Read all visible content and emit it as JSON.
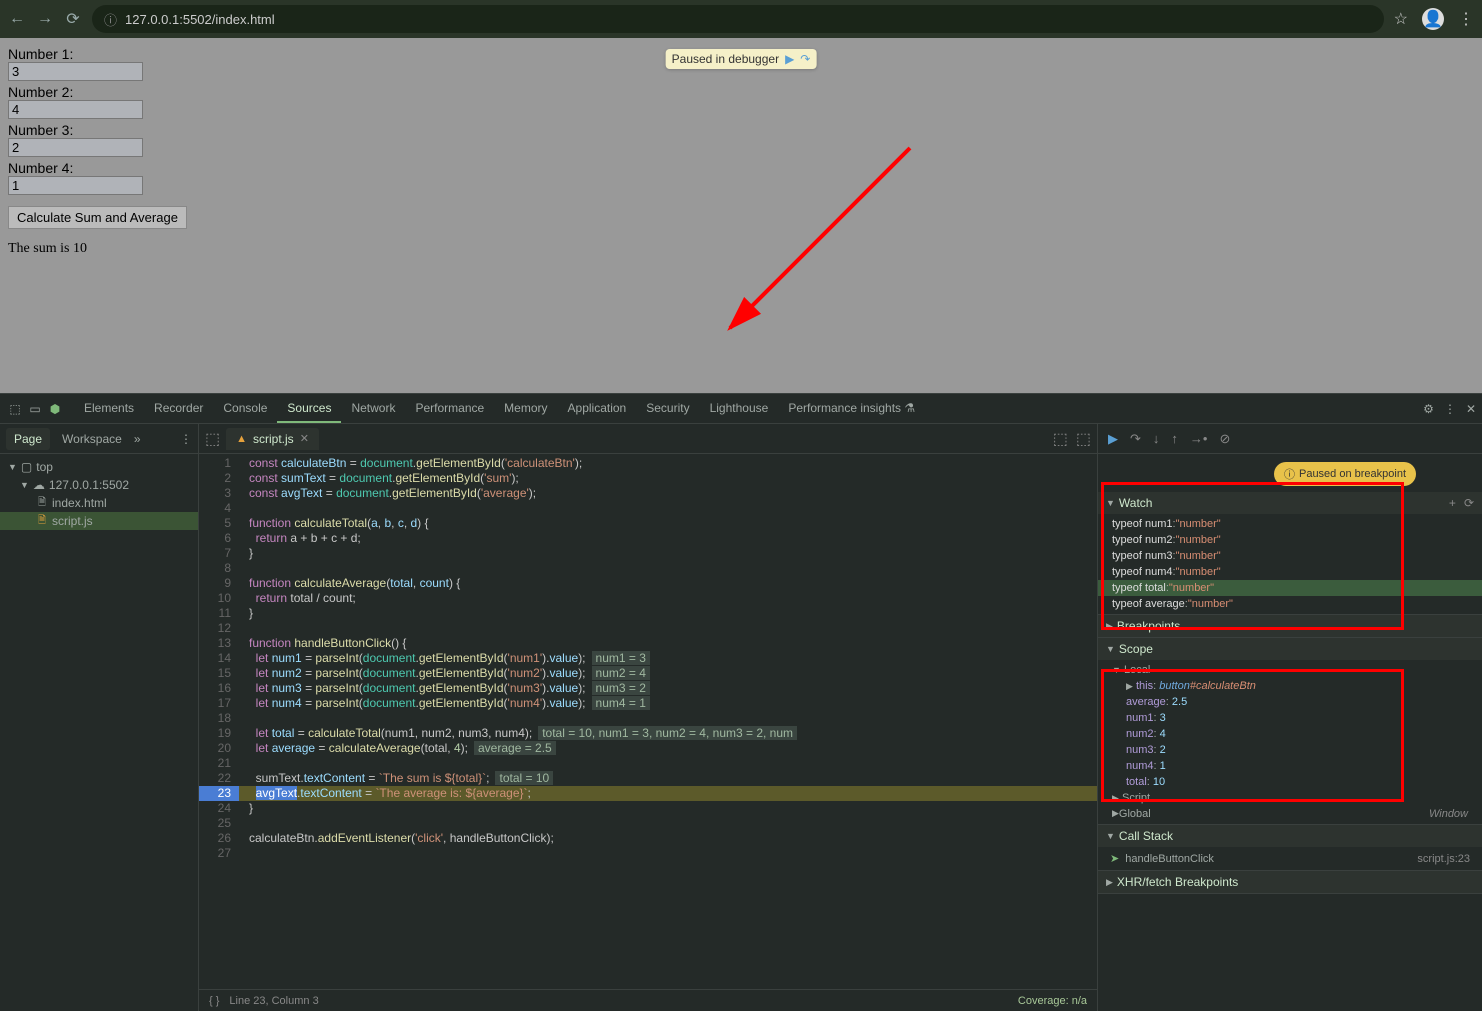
{
  "browser": {
    "url": "127.0.0.1:5502/index.html"
  },
  "page": {
    "labels": [
      "Number 1:",
      "Number 2:",
      "Number 3:",
      "Number 4:"
    ],
    "values": [
      "3",
      "4",
      "2",
      "1"
    ],
    "button": "Calculate Sum and Average",
    "sum_text": "The sum is 10",
    "paused_text": "Paused in debugger"
  },
  "devtools": {
    "tabs": [
      "Elements",
      "Recorder",
      "Console",
      "Sources",
      "Network",
      "Performance",
      "Memory",
      "Application",
      "Security",
      "Lighthouse",
      "Performance insights"
    ],
    "active_tab": "Sources",
    "left": {
      "tabs": [
        "Page",
        "Workspace"
      ],
      "tree": {
        "top": "top",
        "host": "127.0.0.1:5502",
        "files": [
          "index.html",
          "script.js"
        ]
      }
    },
    "source": {
      "filename": "script.js",
      "lines": [
        {
          "n": 1,
          "html": "<span class='tok-kw'>const</span> <span class='tok-var'>calculateBtn</span> = <span class='tok-obj'>document</span>.<span class='tok-fn'>getElementById</span>(<span class='tok-str'>'calculateBtn'</span>);"
        },
        {
          "n": 2,
          "html": "<span class='tok-kw'>const</span> <span class='tok-var'>sumText</span> = <span class='tok-obj'>document</span>.<span class='tok-fn'>getElementById</span>(<span class='tok-str'>'sum'</span>);"
        },
        {
          "n": 3,
          "html": "<span class='tok-kw'>const</span> <span class='tok-var'>avgText</span> = <span class='tok-obj'>document</span>.<span class='tok-fn'>getElementById</span>(<span class='tok-str'>'average'</span>);"
        },
        {
          "n": 4,
          "html": ""
        },
        {
          "n": 5,
          "html": "<span class='tok-kw'>function</span> <span class='tok-fn'>calculateTotal</span>(<span class='tok-var'>a</span>, <span class='tok-var'>b</span>, <span class='tok-var'>c</span>, <span class='tok-var'>d</span>) {"
        },
        {
          "n": 6,
          "html": "  <span class='tok-kw'>return</span> a + b + c + d;"
        },
        {
          "n": 7,
          "html": "}"
        },
        {
          "n": 8,
          "html": ""
        },
        {
          "n": 9,
          "html": "<span class='tok-kw'>function</span> <span class='tok-fn'>calculateAverage</span>(<span class='tok-var'>total</span>, <span class='tok-var'>count</span>) {"
        },
        {
          "n": 10,
          "html": "  <span class='tok-kw'>return</span> total / count;"
        },
        {
          "n": 11,
          "html": "}"
        },
        {
          "n": 12,
          "html": ""
        },
        {
          "n": 13,
          "html": "<span class='tok-kw'>function</span> <span class='tok-fn'>handleButtonClick</span>() {"
        },
        {
          "n": 14,
          "html": "  <span class='tok-kw'>let</span> <span class='tok-var'>num1</span> = <span class='tok-fn'>parseInt</span>(<span class='tok-obj'>document</span>.<span class='tok-fn'>getElementById</span>(<span class='tok-str'>'num1'</span>).<span class='tok-var'>value</span>);",
          "iv": "num1 = 3"
        },
        {
          "n": 15,
          "html": "  <span class='tok-kw'>let</span> <span class='tok-var'>num2</span> = <span class='tok-fn'>parseInt</span>(<span class='tok-obj'>document</span>.<span class='tok-fn'>getElementById</span>(<span class='tok-str'>'num2'</span>).<span class='tok-var'>value</span>);",
          "iv": "num2 = 4"
        },
        {
          "n": 16,
          "html": "  <span class='tok-kw'>let</span> <span class='tok-var'>num3</span> = <span class='tok-fn'>parseInt</span>(<span class='tok-obj'>document</span>.<span class='tok-fn'>getElementById</span>(<span class='tok-str'>'num3'</span>).<span class='tok-var'>value</span>);",
          "iv": "num3 = 2"
        },
        {
          "n": 17,
          "html": "  <span class='tok-kw'>let</span> <span class='tok-var'>num4</span> = <span class='tok-fn'>parseInt</span>(<span class='tok-obj'>document</span>.<span class='tok-fn'>getElementById</span>(<span class='tok-str'>'num4'</span>).<span class='tok-var'>value</span>);",
          "iv": "num4 = 1"
        },
        {
          "n": 18,
          "html": ""
        },
        {
          "n": 19,
          "html": "  <span class='tok-kw'>let</span> <span class='tok-var'>total</span> = <span class='tok-fn'>calculateTotal</span>(num1, num2, num3, num4);",
          "iv": "total = 10, num1 = 3, num2 = 4, num3 = 2, num"
        },
        {
          "n": 20,
          "html": "  <span class='tok-kw'>let</span> <span class='tok-var'>average</span> = <span class='tok-fn'>calculateAverage</span>(total, <span class='tok-num'>4</span>);",
          "iv": "average = 2.5"
        },
        {
          "n": 21,
          "html": ""
        },
        {
          "n": 22,
          "html": "  sumText.<span class='tok-var'>textContent</span> = <span class='tok-str'>`The sum is ${total}`</span>;",
          "iv": "total = 10"
        },
        {
          "n": 23,
          "html": "  <span style='background:#4a7dd4;color:#fff'>avgText</span>.<span class='tok-var'>textContent</span> = <span class='tok-str'>`The average is: ${average}`</span>;",
          "current": true,
          "bp": true
        },
        {
          "n": 24,
          "html": "}"
        },
        {
          "n": 25,
          "html": ""
        },
        {
          "n": 26,
          "html": "calculateBtn.<span class='tok-fn'>addEventListener</span>(<span class='tok-str'>'click'</span>, handleButtonClick);"
        },
        {
          "n": 27,
          "html": ""
        }
      ],
      "status": "Line 23, Column 3",
      "coverage": "Coverage: n/a"
    },
    "debugger": {
      "paused_banner": "Paused on breakpoint",
      "watch": [
        {
          "expr": "typeof num1",
          "val": "\"number\""
        },
        {
          "expr": "typeof num2",
          "val": "\"number\""
        },
        {
          "expr": "typeof num3",
          "val": "\"number\""
        },
        {
          "expr": "typeof num4",
          "val": "\"number\""
        },
        {
          "expr": "typeof total",
          "val": "\"number\"",
          "hl": true
        },
        {
          "expr": "typeof average",
          "val": "\"number\""
        }
      ],
      "sections": {
        "watch": "Watch",
        "breakpoints": "Breakpoints",
        "scope": "Scope",
        "local": "Local",
        "script": "Script",
        "global": "Global",
        "global_val": "Window",
        "callstack": "Call Stack",
        "xhr": "XHR/fetch Breakpoints"
      },
      "local": [
        {
          "key": "this",
          "val": "button#calculateBtn",
          "type": "obj"
        },
        {
          "key": "average",
          "val": "2.5"
        },
        {
          "key": "num1",
          "val": "3"
        },
        {
          "key": "num2",
          "val": "4"
        },
        {
          "key": "num3",
          "val": "2"
        },
        {
          "key": "num4",
          "val": "1"
        },
        {
          "key": "total",
          "val": "10"
        }
      ],
      "callstack": [
        {
          "fn": "handleButtonClick",
          "loc": "script.js:23"
        }
      ]
    }
  }
}
